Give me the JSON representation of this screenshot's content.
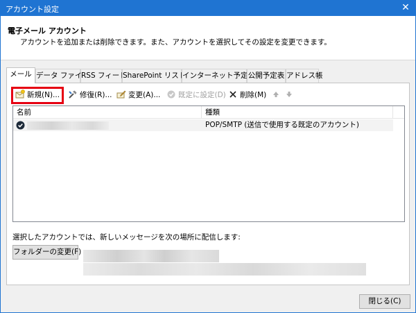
{
  "window": {
    "title": "アカウント設定",
    "close_glyph": "✕",
    "accent_color": "#1f74d2"
  },
  "header": {
    "title": "電子メール アカウント",
    "description": "アカウントを追加または削除できます。また、アカウントを選択してその設定を変更できます。"
  },
  "tabs": [
    {
      "label": "メール",
      "active": true
    },
    {
      "label": "データ ファイル",
      "active": false
    },
    {
      "label": "RSS フィード",
      "active": false
    },
    {
      "label": "SharePoint リスト",
      "active": false
    },
    {
      "label": "インターネット予定表",
      "active": false
    },
    {
      "label": "公開予定表",
      "active": false
    },
    {
      "label": "アドレス帳",
      "active": false
    }
  ],
  "toolbar": {
    "new_label": "新規(N)...",
    "repair_label": "修復(R)...",
    "change_label": "変更(A)...",
    "set_default_label": "既定に設定(D)",
    "remove_label": "削除(M)",
    "up_glyph": "🡅",
    "down_glyph": "🡇",
    "highlight_color": "#e60012",
    "icons": [
      "new-mail-icon",
      "repair-icon",
      "change-icon",
      "default-check-icon",
      "delete-x-icon",
      "up-arrow-icon",
      "down-arrow-icon"
    ]
  },
  "accounts": {
    "columns": [
      "名前",
      "種類"
    ],
    "rows": [
      {
        "name": "",
        "type": "POP/SMTP (送信で使用する既定のアカウント)",
        "default": true
      }
    ]
  },
  "delivery": {
    "label": "選択したアカウントでは、新しいメッセージを次の場所に配信します:",
    "change_folder_label": "フォルダーの変更(F)"
  },
  "footer": {
    "close_label": "閉じる(C)"
  }
}
